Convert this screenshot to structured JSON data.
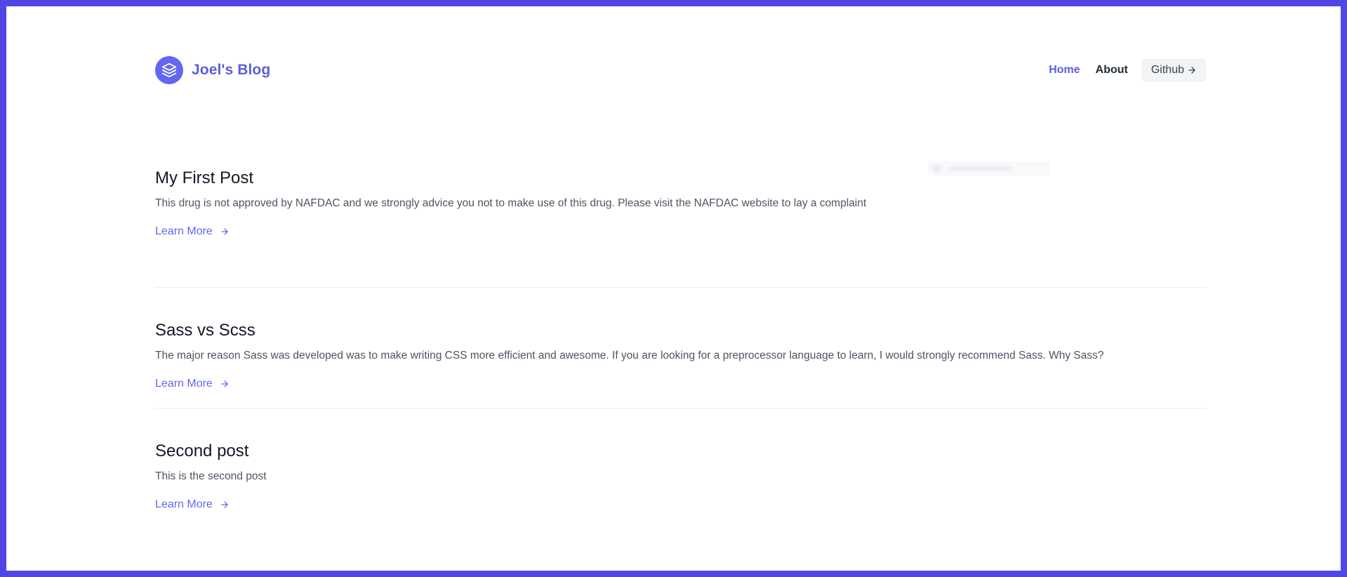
{
  "colors": {
    "frame": "#4F46E5",
    "accent": "#6366F1",
    "brand_text": "#5B5FD8"
  },
  "header": {
    "brand": {
      "logo_icon": "stack-icon",
      "name": "Joel's Blog"
    },
    "nav": {
      "home": "Home",
      "about": "About",
      "github": "Github",
      "github_icon": "arrow-right-icon"
    }
  },
  "posts": [
    {
      "title": "My First Post",
      "excerpt": "This drug is not approved by NAFDAC and we strongly advice you not to make use of this drug. Please visit the NAFDAC website to lay a complaint",
      "link_label": "Learn More",
      "link_icon": "arrow-right-icon"
    },
    {
      "title": "Sass vs Scss",
      "excerpt": "The major reason Sass was developed was to make writing CSS more efficient and awesome. If you are looking for a preprocessor language to learn, I would strongly recommend Sass. Why Sass?",
      "link_label": "Learn More",
      "link_icon": "arrow-right-icon"
    },
    {
      "title": "Second post",
      "excerpt": "This is the second post",
      "link_label": "Learn More",
      "link_icon": "arrow-right-icon"
    }
  ]
}
